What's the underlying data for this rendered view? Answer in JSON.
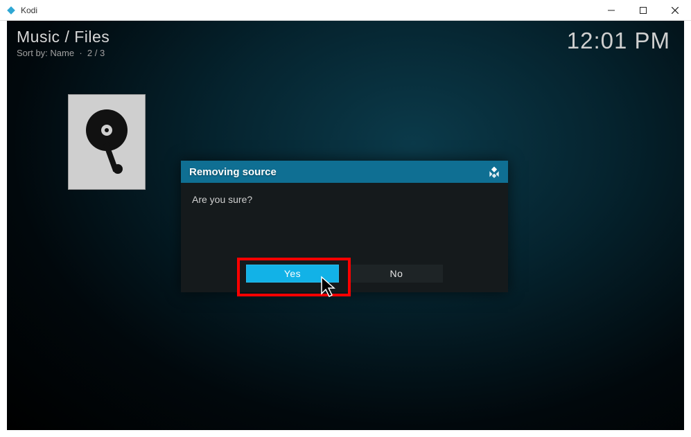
{
  "window": {
    "title": "Kodi",
    "controls": {
      "minimize": "—",
      "maximize": "▢",
      "close": "✕"
    }
  },
  "header": {
    "breadcrumb": "Music / Files",
    "sort_label": "Sort by: Name",
    "sort_sep": "·",
    "page_info": "2 / 3"
  },
  "clock": "12:01 PM",
  "dialog": {
    "title": "Removing source",
    "message": "Are you sure?",
    "yes_label": "Yes",
    "no_label": "No"
  },
  "icons": {
    "drive": "disk-drive-icon",
    "kodi": "kodi-icon"
  }
}
